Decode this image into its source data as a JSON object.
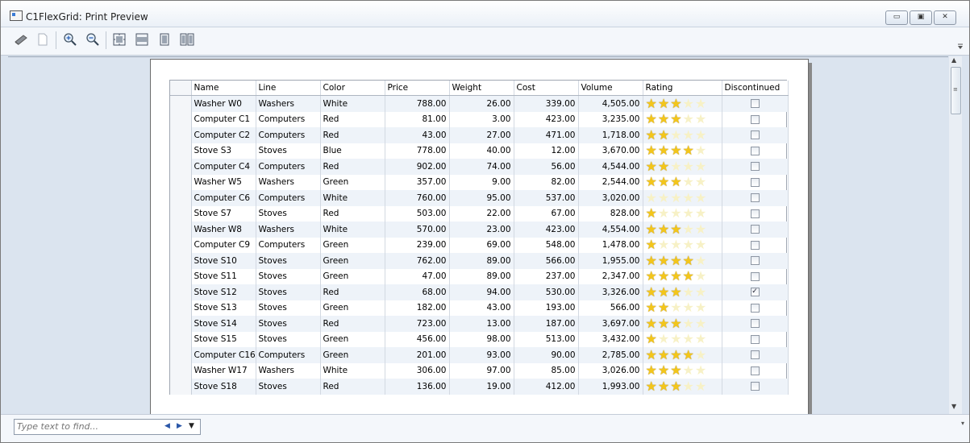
{
  "window": {
    "title": "C1FlexGrid: Print Preview",
    "minimize": "▭",
    "maximize": "▣",
    "close": "✕"
  },
  "find": {
    "placeholder": "Type text to find...",
    "prev": "◀",
    "next": "▶",
    "dropdown": "▼"
  },
  "toolbar": {
    "icons": [
      "print-icon",
      "page-setup-icon",
      "zoom-in-icon",
      "zoom-out-icon",
      "fit-page-icon",
      "fit-width-icon",
      "single-page-icon",
      "two-page-icon"
    ]
  },
  "grid": {
    "columns": [
      "Name",
      "Line",
      "Color",
      "Price",
      "Weight",
      "Cost",
      "Volume",
      "Rating",
      "Discontinued"
    ],
    "rows": [
      {
        "name": "Washer W0",
        "line": "Washers",
        "color": "White",
        "price": "788.00",
        "weight": "26.00",
        "cost": "339.00",
        "volume": "4,505.00",
        "rating": 3,
        "discontinued": false
      },
      {
        "name": "Computer C1",
        "line": "Computers",
        "color": "Red",
        "price": "81.00",
        "weight": "3.00",
        "cost": "423.00",
        "volume": "3,235.00",
        "rating": 3,
        "discontinued": false
      },
      {
        "name": "Computer C2",
        "line": "Computers",
        "color": "Red",
        "price": "43.00",
        "weight": "27.00",
        "cost": "471.00",
        "volume": "1,718.00",
        "rating": 2,
        "discontinued": false
      },
      {
        "name": "Stove S3",
        "line": "Stoves",
        "color": "Blue",
        "price": "778.00",
        "weight": "40.00",
        "cost": "12.00",
        "volume": "3,670.00",
        "rating": 4,
        "discontinued": false
      },
      {
        "name": "Computer C4",
        "line": "Computers",
        "color": "Red",
        "price": "902.00",
        "weight": "74.00",
        "cost": "56.00",
        "volume": "4,544.00",
        "rating": 2,
        "discontinued": false
      },
      {
        "name": "Washer W5",
        "line": "Washers",
        "color": "Green",
        "price": "357.00",
        "weight": "9.00",
        "cost": "82.00",
        "volume": "2,544.00",
        "rating": 3,
        "discontinued": false
      },
      {
        "name": "Computer C6",
        "line": "Computers",
        "color": "White",
        "price": "760.00",
        "weight": "95.00",
        "cost": "537.00",
        "volume": "3,020.00",
        "rating": 0,
        "discontinued": false
      },
      {
        "name": "Stove S7",
        "line": "Stoves",
        "color": "Red",
        "price": "503.00",
        "weight": "22.00",
        "cost": "67.00",
        "volume": "828.00",
        "rating": 1,
        "discontinued": false
      },
      {
        "name": "Washer W8",
        "line": "Washers",
        "color": "White",
        "price": "570.00",
        "weight": "23.00",
        "cost": "423.00",
        "volume": "4,554.00",
        "rating": 3,
        "discontinued": false
      },
      {
        "name": "Computer C9",
        "line": "Computers",
        "color": "Green",
        "price": "239.00",
        "weight": "69.00",
        "cost": "548.00",
        "volume": "1,478.00",
        "rating": 1,
        "discontinued": false
      },
      {
        "name": "Stove S10",
        "line": "Stoves",
        "color": "Green",
        "price": "762.00",
        "weight": "89.00",
        "cost": "566.00",
        "volume": "1,955.00",
        "rating": 4,
        "discontinued": false
      },
      {
        "name": "Stove S11",
        "line": "Stoves",
        "color": "Green",
        "price": "47.00",
        "weight": "89.00",
        "cost": "237.00",
        "volume": "2,347.00",
        "rating": 4,
        "discontinued": false
      },
      {
        "name": "Stove S12",
        "line": "Stoves",
        "color": "Red",
        "price": "68.00",
        "weight": "94.00",
        "cost": "530.00",
        "volume": "3,326.00",
        "rating": 3,
        "discontinued": true
      },
      {
        "name": "Stove S13",
        "line": "Stoves",
        "color": "Green",
        "price": "182.00",
        "weight": "43.00",
        "cost": "193.00",
        "volume": "566.00",
        "rating": 2,
        "discontinued": false
      },
      {
        "name": "Stove S14",
        "line": "Stoves",
        "color": "Red",
        "price": "723.00",
        "weight": "13.00",
        "cost": "187.00",
        "volume": "3,697.00",
        "rating": 3,
        "discontinued": false
      },
      {
        "name": "Stove S15",
        "line": "Stoves",
        "color": "Green",
        "price": "456.00",
        "weight": "98.00",
        "cost": "513.00",
        "volume": "3,432.00",
        "rating": 1,
        "discontinued": false
      },
      {
        "name": "Computer C16",
        "line": "Computers",
        "color": "Green",
        "price": "201.00",
        "weight": "93.00",
        "cost": "90.00",
        "volume": "2,785.00",
        "rating": 4,
        "discontinued": false
      },
      {
        "name": "Washer W17",
        "line": "Washers",
        "color": "White",
        "price": "306.00",
        "weight": "97.00",
        "cost": "85.00",
        "volume": "3,026.00",
        "rating": 3,
        "discontinued": false
      },
      {
        "name": "Stove S18",
        "line": "Stoves",
        "color": "Red",
        "price": "136.00",
        "weight": "19.00",
        "cost": "412.00",
        "volume": "1,993.00",
        "rating": 3,
        "discontinued": false
      }
    ]
  }
}
